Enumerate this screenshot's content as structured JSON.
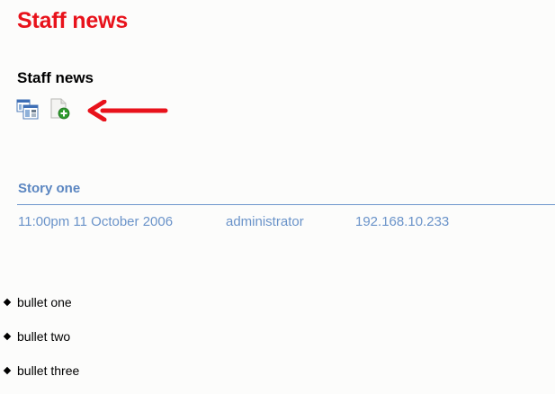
{
  "page": {
    "title": "Staff news"
  },
  "section": {
    "title": "Staff news"
  },
  "toolbar": {
    "buttons": [
      {
        "name": "view-layout",
        "icon": "window-layout-icon"
      },
      {
        "name": "add-item",
        "icon": "add-page-icon"
      }
    ],
    "arrow_icon": "red-arrow-icon",
    "arrow_color": "#e8121b"
  },
  "story": {
    "title": "Story one",
    "datetime": "11:00pm 11 October 2006",
    "author": "administrator",
    "ip": "192.168.10.233",
    "bullets": [
      "bullet one",
      "bullet two",
      "bullet three"
    ]
  },
  "colors": {
    "title": "#e8121b",
    "link": "#5b86c1",
    "rule": "#6e97cc"
  }
}
